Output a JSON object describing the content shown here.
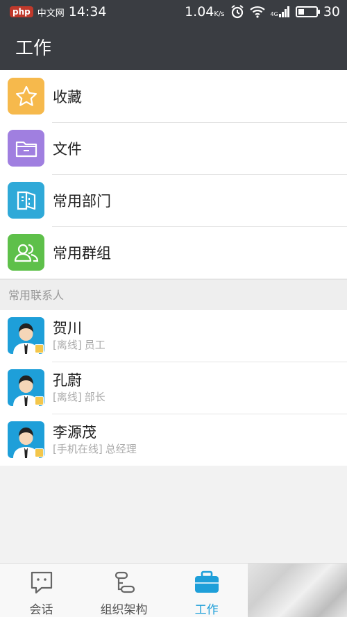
{
  "status_bar": {
    "time": "14:34",
    "watermark_logo": "php",
    "watermark_text": "中文网",
    "speed": "1.04",
    "speed_unit": "K/s",
    "network": "4G",
    "battery": "30"
  },
  "header": {
    "title": "工作"
  },
  "menu": [
    {
      "label": "收藏",
      "color": "#f6b94c",
      "icon": "star-icon"
    },
    {
      "label": "文件",
      "color": "#a07fe0",
      "icon": "folder-icon"
    },
    {
      "label": "常用部门",
      "color": "#2fa9d8",
      "icon": "department-icon"
    },
    {
      "label": "常用群组",
      "color": "#5ec04a",
      "icon": "group-icon"
    }
  ],
  "section": {
    "contacts_title": "常用联系人"
  },
  "contacts": [
    {
      "name": "贺川",
      "status": "[离线]",
      "role": "员工"
    },
    {
      "name": "孔蔚",
      "status": "[离线]",
      "role": "部长"
    },
    {
      "name": "李源茂",
      "status": "[手机在线]",
      "role": "总经理"
    }
  ],
  "tabs": [
    {
      "label": "会话",
      "icon": "chat-icon"
    },
    {
      "label": "组织架构",
      "icon": "org-icon"
    },
    {
      "label": "工作",
      "icon": "briefcase-icon"
    }
  ]
}
